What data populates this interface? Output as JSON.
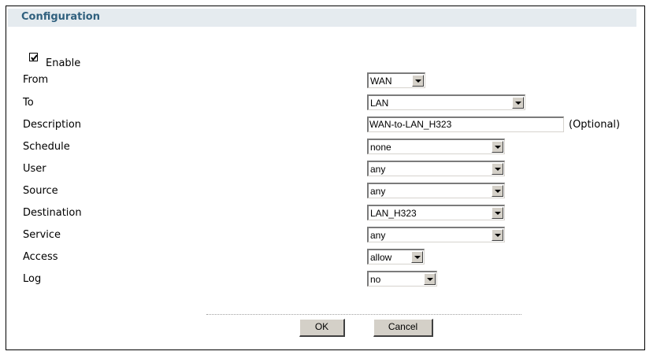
{
  "section": {
    "title": "Configuration"
  },
  "enable": {
    "label": "Enable",
    "checked": true
  },
  "fields": {
    "from": {
      "label": "From",
      "value": "WAN"
    },
    "to": {
      "label": "To",
      "value": "LAN"
    },
    "description": {
      "label": "Description",
      "value": "WAN-to-LAN_H323",
      "note": "(Optional)"
    },
    "schedule": {
      "label": "Schedule",
      "value": "none"
    },
    "user": {
      "label": "User",
      "value": "any"
    },
    "source": {
      "label": "Source",
      "value": "any"
    },
    "destination": {
      "label": "Destination",
      "value": "LAN_H323"
    },
    "service": {
      "label": "Service",
      "value": "any"
    },
    "access": {
      "label": "Access",
      "value": "allow"
    },
    "log": {
      "label": "Log",
      "value": "no"
    }
  },
  "buttons": {
    "ok": "OK",
    "cancel": "Cancel"
  },
  "colors": {
    "header_bg": "#e5ebef",
    "header_text": "#30607e",
    "button_face": "#d4d0c8"
  }
}
